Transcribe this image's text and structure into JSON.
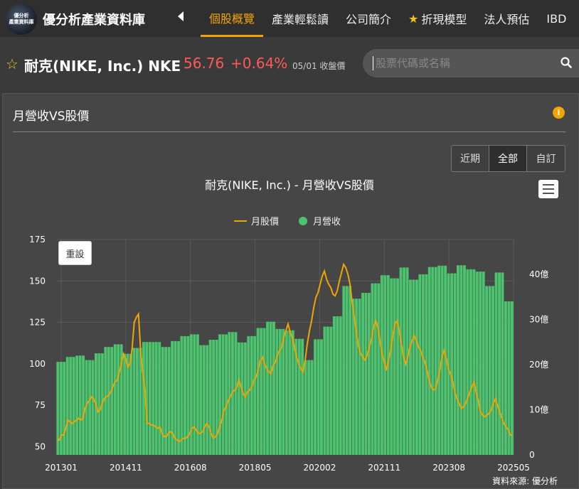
{
  "header": {
    "logo_text": [
      "優分析",
      "產業資料庫"
    ],
    "site_title": "優分析產業資料庫",
    "nav": [
      {
        "label": "個股概覽",
        "active": true
      },
      {
        "label": "產業輕鬆讀",
        "active": false
      },
      {
        "label": "公司簡介",
        "active": false
      },
      {
        "label": "折現模型",
        "active": false,
        "icon": "star-icon"
      },
      {
        "label": "法人預估",
        "active": false
      },
      {
        "label": "IBD",
        "active": false
      }
    ]
  },
  "stock": {
    "name": "耐克(NIKE, Inc.) NKE",
    "price": "56.76",
    "change": "+0.64%",
    "date": "05/01 收盤價"
  },
  "search": {
    "placeholder": "股票代碼或名稱"
  },
  "panel": {
    "title": "月營收VS股價",
    "range_buttons": [
      {
        "label": "近期",
        "active": false
      },
      {
        "label": "全部",
        "active": true
      },
      {
        "label": "自訂",
        "active": false
      }
    ],
    "reset_label": "重設"
  },
  "colors": {
    "accent": "#f0a500",
    "price_red": "#ff5a5a",
    "revenue_green": "#4cc36f",
    "price_line": "#f0a500"
  },
  "chart_data": {
    "type": "bar+line",
    "title": "耐克(NIKE, Inc.) - 月營收VS股價",
    "legend": [
      {
        "name": "月股價",
        "type": "line"
      },
      {
        "name": "月營收",
        "type": "bar"
      }
    ],
    "legend_position": "top-center",
    "left_axis": {
      "ticks": [
        175,
        150,
        125,
        100,
        75,
        50
      ],
      "range": [
        45,
        175
      ]
    },
    "right_axis": {
      "ticks": [
        "40億",
        "30億",
        "20億",
        "10億",
        "0"
      ],
      "range": [
        0,
        47.7
      ]
    },
    "x_ticks": [
      "201301",
      "201411",
      "201608",
      "201805",
      "202002",
      "202111",
      "202308",
      "202505"
    ],
    "source": "資料來源: 優分析",
    "revenue_quarterly": [
      20.6,
      21.7,
      22.0,
      21.0,
      22.5,
      23.9,
      24.5,
      22.4,
      23.7,
      25.0,
      25.0,
      23.9,
      25.2,
      26.3,
      26.7,
      24.3,
      25.5,
      26.7,
      27.2,
      24.9,
      26.3,
      28.1,
      29.5,
      27.9,
      27.6,
      25.7,
      21.0,
      25.6,
      28.4,
      30.7,
      37.4,
      34.6,
      35.9,
      38.0,
      39.8,
      39.1,
      41.5,
      38.8,
      40.0,
      41.6,
      41.9,
      40.2,
      42.0,
      41.1,
      40.6,
      37.4,
      40.4,
      34.0
    ],
    "price_monthly": [
      54,
      54,
      57,
      57,
      61,
      66,
      65,
      64,
      65,
      66,
      67,
      66,
      67,
      73,
      76,
      78,
      80,
      79,
      76,
      71,
      72,
      76,
      79,
      80,
      81,
      83,
      86,
      89,
      90,
      95,
      100,
      106,
      103,
      98,
      100,
      109,
      125,
      128,
      130,
      108,
      95,
      84,
      64,
      64,
      63,
      63,
      62,
      61,
      62,
      58,
      56,
      56,
      58,
      59,
      58,
      55,
      54,
      53,
      54,
      55,
      55,
      56,
      58,
      61,
      62,
      60,
      58,
      58,
      59,
      62,
      64,
      62,
      58,
      55,
      56,
      58,
      62,
      66,
      72,
      74,
      78,
      80,
      83,
      84,
      86,
      90,
      86,
      82,
      80,
      83,
      84,
      86,
      90,
      92,
      96,
      102,
      104,
      100,
      97,
      95,
      94,
      99,
      101,
      105,
      108,
      110,
      116,
      120,
      124,
      119,
      116,
      110,
      104,
      100,
      97,
      95,
      102,
      112,
      120,
      126,
      134,
      140,
      143,
      148,
      153,
      156,
      151,
      148,
      146,
      142,
      141,
      144,
      150,
      155,
      160,
      158,
      154,
      148,
      137,
      128,
      118,
      110,
      106,
      104,
      102,
      105,
      110,
      115,
      122,
      126,
      122,
      114,
      106,
      101,
      96,
      102,
      108,
      117,
      124,
      126,
      120,
      112,
      104,
      100,
      104,
      110,
      114,
      117,
      114,
      110,
      108,
      104,
      101,
      96,
      90,
      86,
      84,
      85,
      90,
      96,
      104,
      108,
      103,
      97,
      94,
      89,
      83,
      79,
      76,
      73,
      74,
      76,
      79,
      83,
      86,
      89,
      83,
      78,
      71,
      69,
      68,
      69,
      70,
      72,
      76,
      79,
      75,
      71,
      67,
      64,
      62,
      60,
      57,
      56.76
    ]
  }
}
